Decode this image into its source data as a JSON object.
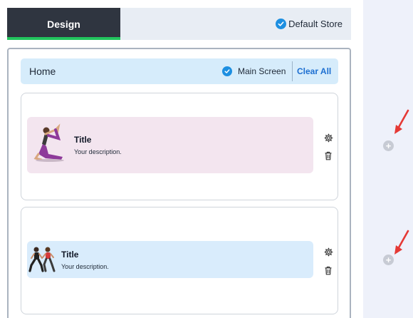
{
  "tabs": {
    "design_label": "Design",
    "store_label": "Default Store"
  },
  "home_bar": {
    "title": "Home",
    "main_screen_label": "Main Screen",
    "clear_all_label": "Clear All"
  },
  "cards": [
    {
      "title": "Title",
      "description": "Your description.",
      "background": "#f3e5ef",
      "image": "yoga-pose-image"
    },
    {
      "title": "Title",
      "description": "Your description.",
      "background": "#d9ecfc",
      "image": "fitness-couple-image"
    }
  ],
  "right_panel": {
    "add_button_label": "+"
  },
  "colors": {
    "accent_blue": "#1d8fe1",
    "active_tab": "#2f3540",
    "active_tab_underline": "#22c55e",
    "arrow_red": "#e53935"
  },
  "icons": [
    "check-circle-icon",
    "gear-icon",
    "trash-icon",
    "plus-circle-icon",
    "red-arrow-icon"
  ]
}
